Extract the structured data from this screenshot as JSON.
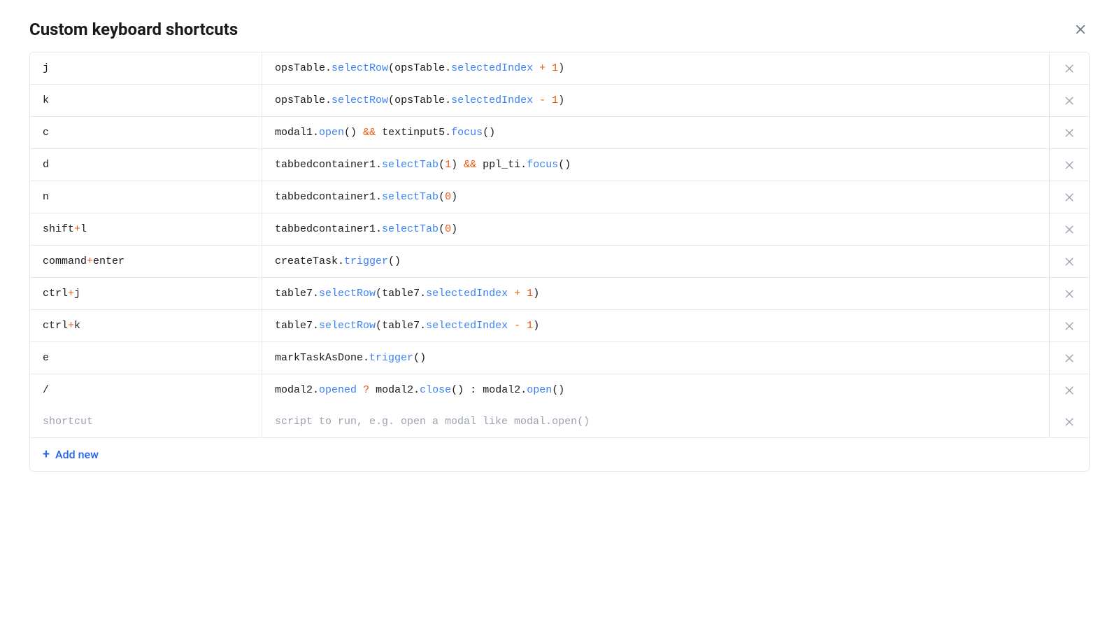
{
  "title": "Custom keyboard shortcuts",
  "add_new_label": "Add new",
  "placeholder_row": {
    "shortcut": "shortcut",
    "script": "script to run, e.g. open a modal like modal.open()"
  },
  "rows": [
    {
      "key_tokens": [
        [
          "plain",
          "j"
        ]
      ],
      "script_tokens": [
        [
          "plain",
          "opsTable"
        ],
        [
          "punc",
          "."
        ],
        [
          "method",
          "selectRow"
        ],
        [
          "punc",
          "("
        ],
        [
          "plain",
          "opsTable"
        ],
        [
          "punc",
          "."
        ],
        [
          "prop",
          "selectedIndex"
        ],
        [
          "plain",
          " "
        ],
        [
          "op",
          "+"
        ],
        [
          "plain",
          " "
        ],
        [
          "num",
          "1"
        ],
        [
          "punc",
          ")"
        ]
      ]
    },
    {
      "key_tokens": [
        [
          "plain",
          "k"
        ]
      ],
      "script_tokens": [
        [
          "plain",
          "opsTable"
        ],
        [
          "punc",
          "."
        ],
        [
          "method",
          "selectRow"
        ],
        [
          "punc",
          "("
        ],
        [
          "plain",
          "opsTable"
        ],
        [
          "punc",
          "."
        ],
        [
          "prop",
          "selectedIndex"
        ],
        [
          "plain",
          " "
        ],
        [
          "op",
          "-"
        ],
        [
          "plain",
          " "
        ],
        [
          "num",
          "1"
        ],
        [
          "punc",
          ")"
        ]
      ]
    },
    {
      "key_tokens": [
        [
          "plain",
          "c"
        ]
      ],
      "script_tokens": [
        [
          "plain",
          "modal1"
        ],
        [
          "punc",
          "."
        ],
        [
          "method",
          "open"
        ],
        [
          "punc",
          "()"
        ],
        [
          "plain",
          " "
        ],
        [
          "op",
          "&&"
        ],
        [
          "plain",
          " "
        ],
        [
          "plain",
          "textinput5"
        ],
        [
          "punc",
          "."
        ],
        [
          "method",
          "focus"
        ],
        [
          "punc",
          "()"
        ]
      ]
    },
    {
      "key_tokens": [
        [
          "plain",
          "d"
        ]
      ],
      "script_tokens": [
        [
          "plain",
          "tabbedcontainer1"
        ],
        [
          "punc",
          "."
        ],
        [
          "method",
          "selectTab"
        ],
        [
          "punc",
          "("
        ],
        [
          "num",
          "1"
        ],
        [
          "punc",
          ")"
        ],
        [
          "plain",
          " "
        ],
        [
          "op",
          "&&"
        ],
        [
          "plain",
          " "
        ],
        [
          "plain",
          "ppl_ti"
        ],
        [
          "punc",
          "."
        ],
        [
          "method",
          "focus"
        ],
        [
          "punc",
          "()"
        ]
      ]
    },
    {
      "key_tokens": [
        [
          "plain",
          "n"
        ]
      ],
      "script_tokens": [
        [
          "plain",
          "tabbedcontainer1"
        ],
        [
          "punc",
          "."
        ],
        [
          "method",
          "selectTab"
        ],
        [
          "punc",
          "("
        ],
        [
          "num",
          "0"
        ],
        [
          "punc",
          ")"
        ]
      ]
    },
    {
      "key_tokens": [
        [
          "plain",
          "shift"
        ],
        [
          "op",
          "+"
        ],
        [
          "plain",
          "l"
        ]
      ],
      "script_tokens": [
        [
          "plain",
          "tabbedcontainer1"
        ],
        [
          "punc",
          "."
        ],
        [
          "method",
          "selectTab"
        ],
        [
          "punc",
          "("
        ],
        [
          "num",
          "0"
        ],
        [
          "punc",
          ")"
        ]
      ]
    },
    {
      "key_tokens": [
        [
          "plain",
          "command"
        ],
        [
          "op",
          "+"
        ],
        [
          "plain",
          "enter"
        ]
      ],
      "script_tokens": [
        [
          "plain",
          "createTask"
        ],
        [
          "punc",
          "."
        ],
        [
          "method",
          "trigger"
        ],
        [
          "punc",
          "()"
        ]
      ]
    },
    {
      "key_tokens": [
        [
          "plain",
          "ctrl"
        ],
        [
          "op",
          "+"
        ],
        [
          "plain",
          "j"
        ]
      ],
      "script_tokens": [
        [
          "plain",
          "table7"
        ],
        [
          "punc",
          "."
        ],
        [
          "method",
          "selectRow"
        ],
        [
          "punc",
          "("
        ],
        [
          "plain",
          "table7"
        ],
        [
          "punc",
          "."
        ],
        [
          "prop",
          "selectedIndex"
        ],
        [
          "plain",
          " "
        ],
        [
          "op",
          "+"
        ],
        [
          "plain",
          " "
        ],
        [
          "num",
          "1"
        ],
        [
          "punc",
          ")"
        ]
      ]
    },
    {
      "key_tokens": [
        [
          "plain",
          "ctrl"
        ],
        [
          "op",
          "+"
        ],
        [
          "plain",
          "k"
        ]
      ],
      "script_tokens": [
        [
          "plain",
          "table7"
        ],
        [
          "punc",
          "."
        ],
        [
          "method",
          "selectRow"
        ],
        [
          "punc",
          "("
        ],
        [
          "plain",
          "table7"
        ],
        [
          "punc",
          "."
        ],
        [
          "prop",
          "selectedIndex"
        ],
        [
          "plain",
          " "
        ],
        [
          "op",
          "-"
        ],
        [
          "plain",
          " "
        ],
        [
          "num",
          "1"
        ],
        [
          "punc",
          ")"
        ]
      ]
    },
    {
      "key_tokens": [
        [
          "plain",
          "e"
        ]
      ],
      "script_tokens": [
        [
          "plain",
          "markTaskAsDone"
        ],
        [
          "punc",
          "."
        ],
        [
          "method",
          "trigger"
        ],
        [
          "punc",
          "()"
        ]
      ]
    },
    {
      "key_tokens": [
        [
          "plain",
          "/"
        ]
      ],
      "script_tokens": [
        [
          "plain",
          "modal2"
        ],
        [
          "punc",
          "."
        ],
        [
          "prop",
          "opened"
        ],
        [
          "plain",
          " "
        ],
        [
          "op",
          "?"
        ],
        [
          "plain",
          " "
        ],
        [
          "plain",
          "modal2"
        ],
        [
          "punc",
          "."
        ],
        [
          "method",
          "close"
        ],
        [
          "punc",
          "()"
        ],
        [
          "plain",
          " "
        ],
        [
          "punc",
          ":"
        ],
        [
          "plain",
          " "
        ],
        [
          "plain",
          "modal2"
        ],
        [
          "punc",
          "."
        ],
        [
          "method",
          "open"
        ],
        [
          "punc",
          "()"
        ]
      ]
    }
  ]
}
